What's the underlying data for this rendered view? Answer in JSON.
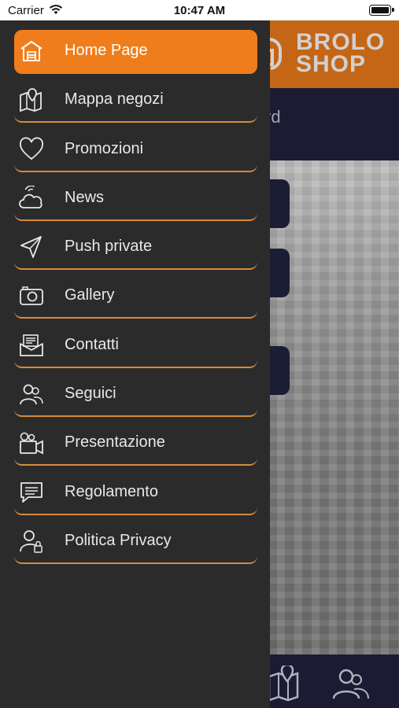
{
  "status_bar": {
    "carrier": "Carrier",
    "time": "10:47 AM"
  },
  "app": {
    "logo_line1": "BROLO",
    "logo_line2": "SHOP",
    "subheader_title": "Fidelity card",
    "brand_color": "#ef7d1b",
    "navy_color": "#212240"
  },
  "drawer": {
    "items": [
      {
        "label": "Home Page",
        "icon": "home-icon",
        "active": true
      },
      {
        "label": "Mappa negozi",
        "icon": "map-icon",
        "active": false
      },
      {
        "label": "Promozioni",
        "icon": "heart-icon",
        "active": false
      },
      {
        "label": "News",
        "icon": "news-icon",
        "active": false
      },
      {
        "label": "Push private",
        "icon": "send-icon",
        "active": false
      },
      {
        "label": "Gallery",
        "icon": "camera-icon",
        "active": false
      },
      {
        "label": "Contatti",
        "icon": "mail-icon",
        "active": false
      },
      {
        "label": "Seguici",
        "icon": "users-icon",
        "active": false
      },
      {
        "label": "Presentazione",
        "icon": "video-icon",
        "active": false
      },
      {
        "label": "Regolamento",
        "icon": "message-icon",
        "active": false
      },
      {
        "label": "Politica Privacy",
        "icon": "privacy-icon",
        "active": false
      }
    ]
  }
}
